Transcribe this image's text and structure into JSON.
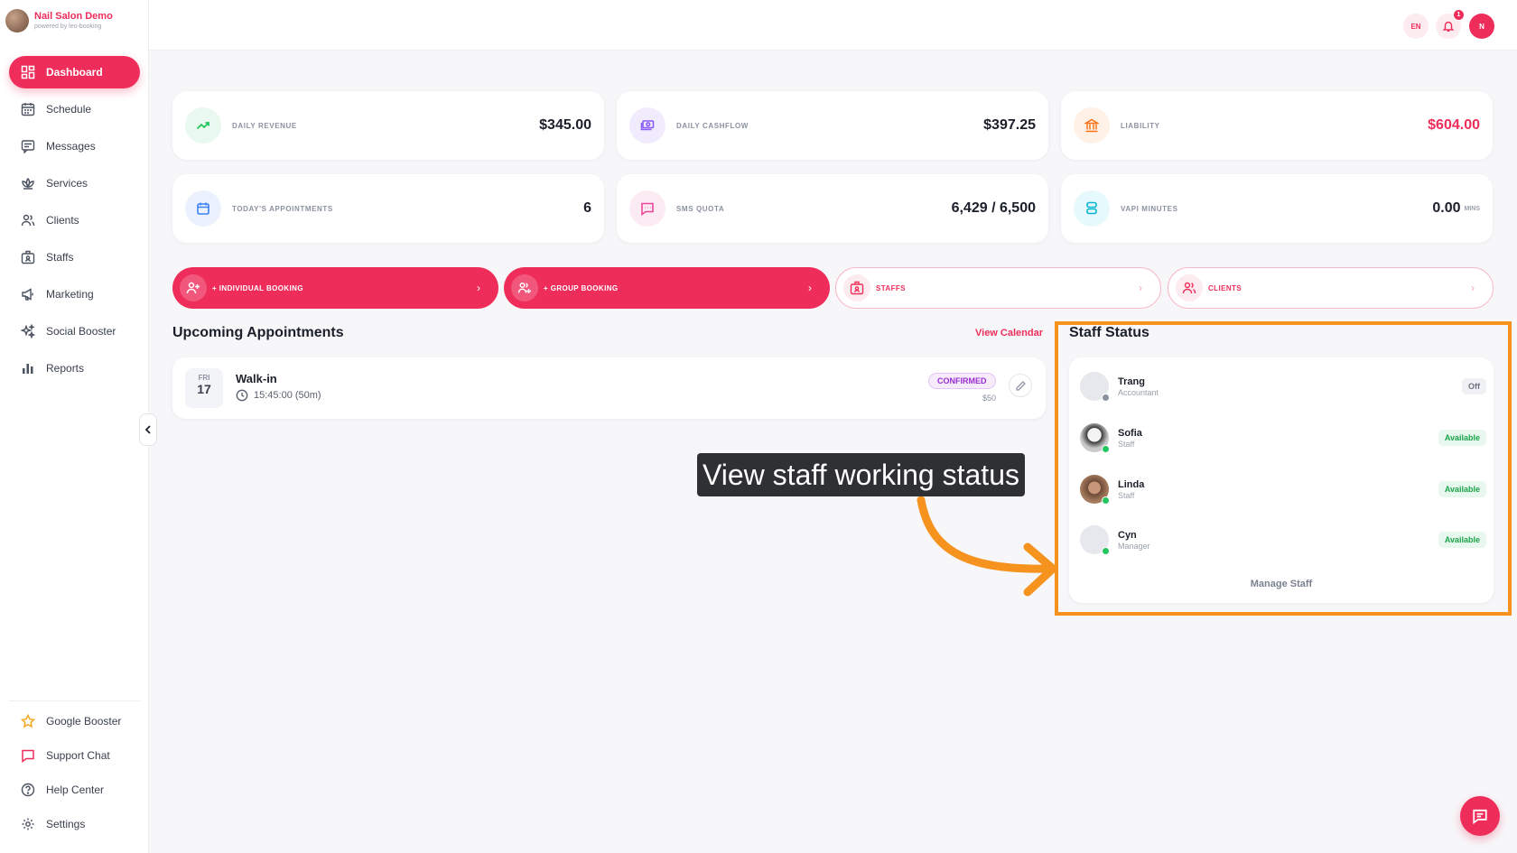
{
  "brand": {
    "name": "Nail Salon Demo",
    "tagline": "powered by leo-booking"
  },
  "nav": {
    "items": [
      {
        "label": "Dashboard",
        "icon": "dashboard-icon",
        "active": true
      },
      {
        "label": "Schedule",
        "icon": "calendar-icon"
      },
      {
        "label": "Messages",
        "icon": "message-icon"
      },
      {
        "label": "Services",
        "icon": "lotus-icon"
      },
      {
        "label": "Clients",
        "icon": "users-icon"
      },
      {
        "label": "Staffs",
        "icon": "id-badge-icon"
      },
      {
        "label": "Marketing",
        "icon": "megaphone-icon"
      },
      {
        "label": "Social Booster",
        "icon": "sparkles-icon"
      },
      {
        "label": "Reports",
        "icon": "bar-chart-icon"
      }
    ],
    "bottom": [
      {
        "label": "Google Booster",
        "icon": "star-icon"
      },
      {
        "label": "Support Chat",
        "icon": "chat-icon"
      },
      {
        "label": "Help Center",
        "icon": "help-circle-icon"
      },
      {
        "label": "Settings",
        "icon": "gear-icon"
      }
    ]
  },
  "header": {
    "language": "EN",
    "notification_count": "1",
    "user_initial": "N"
  },
  "stats": [
    {
      "label": "Daily Revenue",
      "value": "$345.00",
      "icon": "trending-up-icon",
      "color": "#22c55e"
    },
    {
      "label": "Daily Cashflow",
      "value": "$397.25",
      "icon": "cash-icon",
      "color": "#8b5cf6"
    },
    {
      "label": "Liability",
      "value": "$604.00",
      "icon": "bank-icon",
      "color": "#f97316",
      "highlight": true
    },
    {
      "label": "Today's Appointments",
      "value": "6",
      "icon": "calendar-icon",
      "color": "#3b82f6"
    },
    {
      "label": "SMS Quota",
      "value": "6,429 / 6,500",
      "icon": "sms-icon",
      "color": "#ec4899"
    },
    {
      "label": "Vapi Minutes",
      "value": "0.00",
      "unit": "MINS",
      "icon": "database-icon",
      "color": "#06b6d4"
    }
  ],
  "actions": [
    {
      "label": "+ INDIVIDUAL BOOKING",
      "icon": "user-plus-icon",
      "style": "filled"
    },
    {
      "label": "+ GROUP BOOKING",
      "icon": "users-plus-icon",
      "style": "filled"
    },
    {
      "label": "STAFFS",
      "icon": "id-badge-icon",
      "style": "outline"
    },
    {
      "label": "CLIENTS",
      "icon": "users-icon",
      "style": "outline"
    }
  ],
  "upcoming": {
    "title": "Upcoming Appointments",
    "view_calendar": "View Calendar",
    "appointment": {
      "dow": "FRI",
      "day": "17",
      "title": "Walk-in",
      "time": "15:45:00 (50m)",
      "status": "CONFIRMED",
      "price": "$50"
    }
  },
  "staff_status": {
    "title": "Staff Status",
    "manage_label": "Manage Staff",
    "staff": [
      {
        "name": "Trang",
        "role": "Accountant",
        "status": "Off"
      },
      {
        "name": "Sofia",
        "role": "Staff",
        "status": "Available"
      },
      {
        "name": "Linda",
        "role": "Staff",
        "status": "Available"
      },
      {
        "name": "Cyn",
        "role": "Manager",
        "status": "Available"
      }
    ]
  },
  "annotation": {
    "callout": "View staff working status",
    "highlight_color": "#f6921e"
  },
  "colors": {
    "accent": "#ee2d5a",
    "available": "#1aa34a",
    "off": "#6c7280"
  }
}
